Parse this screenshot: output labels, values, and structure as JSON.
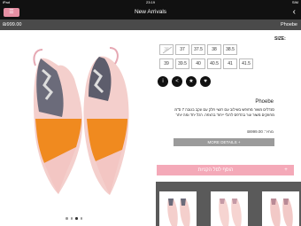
{
  "status_bar": {
    "left": "iPad",
    "time": "23:19",
    "right": "SIM"
  },
  "nav": {
    "title": "New Arrivals",
    "back": "‹",
    "cart": "☰"
  },
  "price_bar": {
    "price": "₪999.00",
    "brand": "Phoebe"
  },
  "product": {
    "image_alt": "Pink and orange slingback pointed-toe flats",
    "dots": 4,
    "active_dot": 2
  },
  "sizes": {
    "label": "SIZE:",
    "row1": [
      "36",
      "37",
      "37.5",
      "38",
      "38.5"
    ],
    "row2": [
      "39",
      "39.5",
      "40",
      "40.5",
      "41",
      "41.5"
    ],
    "row1_unavailable": [
      0
    ]
  },
  "actions": [
    {
      "name": "info-icon",
      "glyph": "i"
    },
    {
      "name": "share-icon",
      "glyph": "<"
    },
    {
      "name": "star-icon",
      "glyph": "★"
    },
    {
      "name": "heart-icon",
      "glyph": "♥"
    }
  ],
  "details": {
    "name": "Phoebe",
    "description": "סנדלים משור מחופש בשילוב עם רגשי חלק עם עקב בגובה 7 ס\"מ מחוזקים משור עור בהדפס לרגלי ייחוד ברצפה. הכל יחד ומה יותר",
    "price": "מחיר: ₪999.00",
    "more_label": "MORE DETAILS +"
  },
  "add_cart": {
    "label": "הוסף לסל הקניות",
    "icon": "+"
  },
  "colors": {
    "accent_pink": "#f4a9b8",
    "dark": "#111111",
    "grey_bar": "#4a4a4a"
  }
}
